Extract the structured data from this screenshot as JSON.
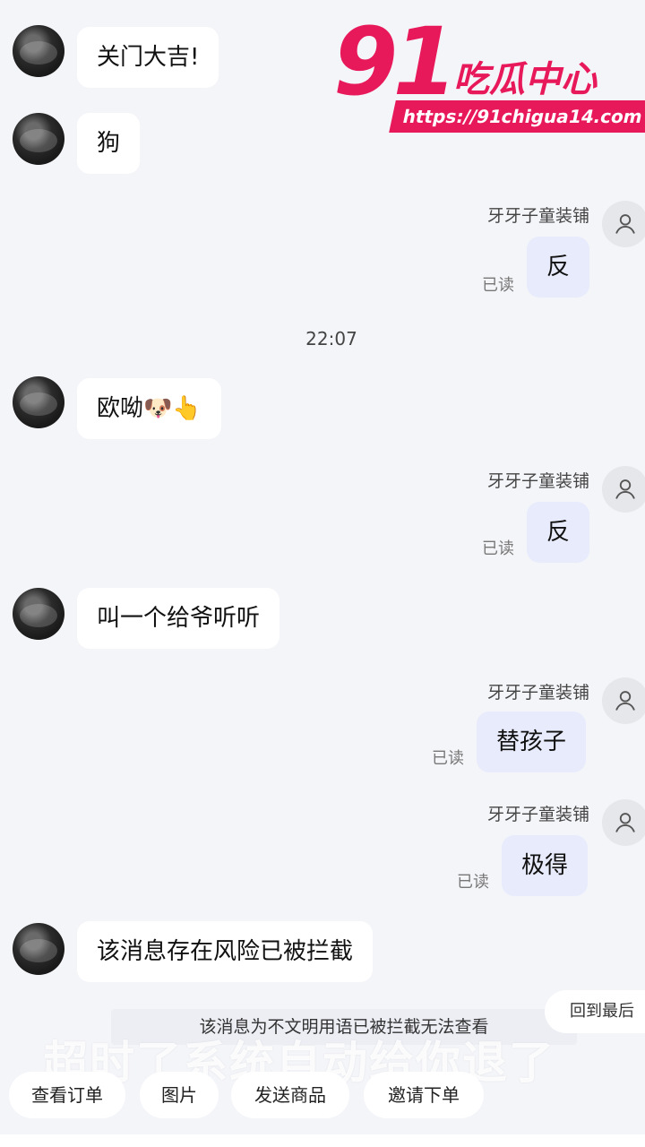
{
  "watermark": {
    "number": "91",
    "name": "吃瓜中心",
    "url": "https://91chigua14.com"
  },
  "shop_name": "牙牙子童装铺",
  "read_label": "已读",
  "messages": [
    {
      "text": "关门大吉!"
    },
    {
      "text": "狗"
    },
    {
      "text": "反"
    },
    {
      "text": "22:07"
    },
    {
      "text": "欧呦",
      "emoji": "🐶👆"
    },
    {
      "text": "反"
    },
    {
      "text": "叫一个给爷听听"
    },
    {
      "text": "替孩子"
    },
    {
      "text": "极得"
    },
    {
      "text": "该消息存在风险已被拦截"
    }
  ],
  "notice": "该消息为不文明用语已被拦截无法查看",
  "back_to_latest": "回到最后",
  "overlay_caption": "超时了系统自动给你退了",
  "quick_actions": [
    "查看订单",
    "图片",
    "发送商品",
    "邀请下单"
  ],
  "colors": {
    "brand_watermark": "#e8195a",
    "bubble_outgoing": "#e8ebfb",
    "bubble_incoming": "#ffffff",
    "background": "#f4f5f9"
  }
}
